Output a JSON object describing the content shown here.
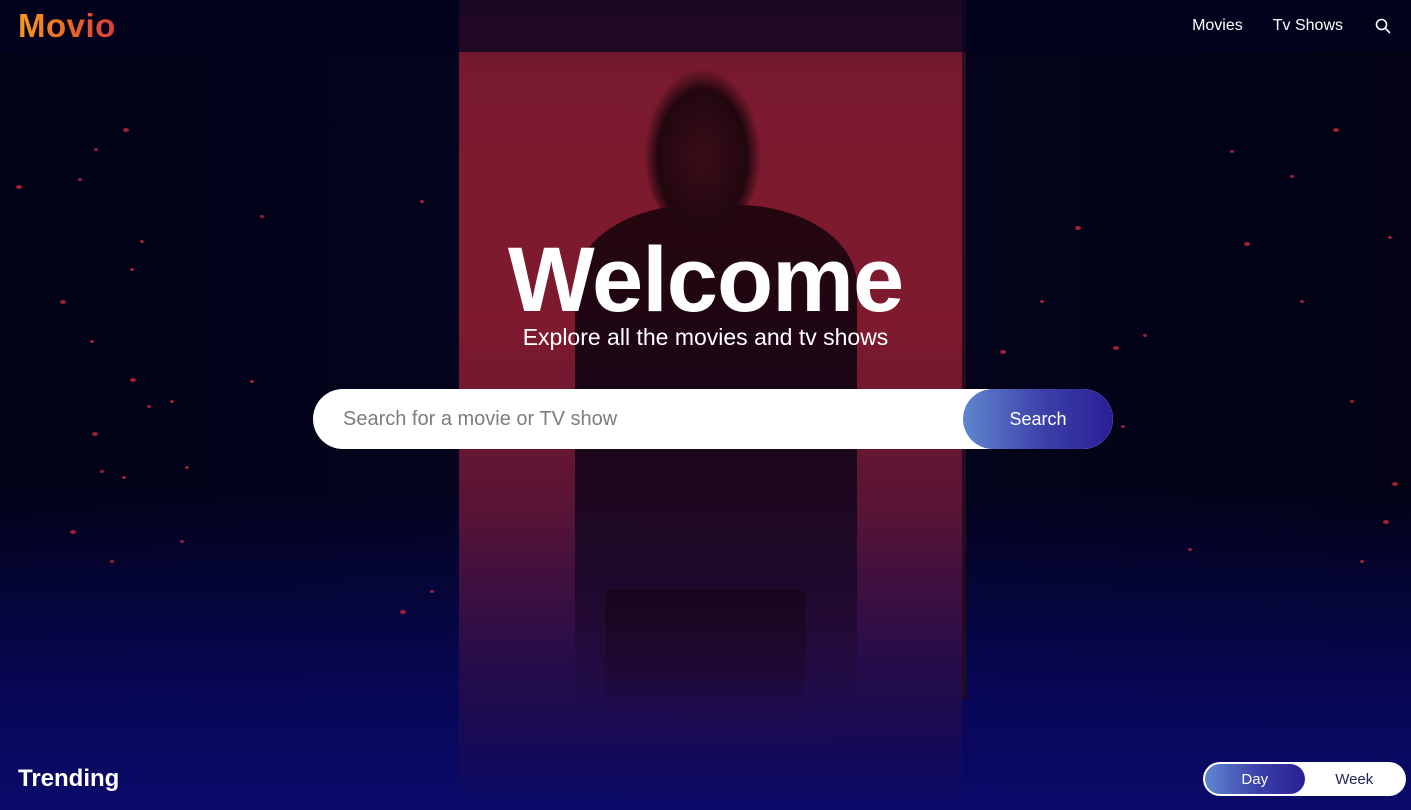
{
  "header": {
    "logo": "Movio",
    "nav": [
      {
        "label": "Movies"
      },
      {
        "label": "Tv Shows"
      }
    ],
    "search_icon": "search-icon"
  },
  "hero": {
    "title": "Welcome",
    "subtitle": "Explore all the movies and tv shows",
    "search": {
      "placeholder": "Search for a movie or TV show",
      "value": "",
      "button_label": "Search"
    }
  },
  "trending": {
    "title": "Trending",
    "toggle": {
      "options": [
        "Day",
        "Week"
      ],
      "selected": "Day"
    }
  },
  "colors": {
    "logo_gradient_start": "#f89a1e",
    "logo_gradient_end": "#dd3b3b",
    "accent_gradient_start": "#5f86cf",
    "accent_gradient_end": "#2a1f96",
    "background": "#04041f"
  }
}
